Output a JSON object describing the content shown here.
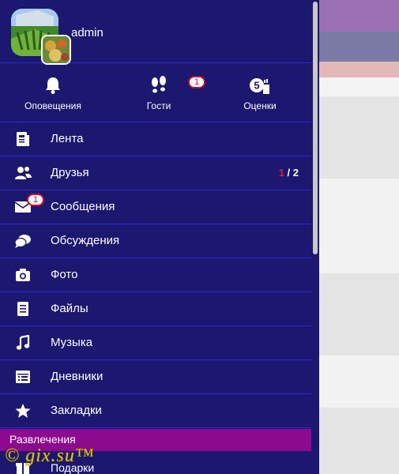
{
  "colors": {
    "drawer_bg": "#1c1870",
    "divider": "#2a2ad8",
    "section_bg": "#8b0a8d",
    "badge_border": "#c8102e",
    "watermark": "#e6c228"
  },
  "profile": {
    "username": "admin"
  },
  "quick_actions": [
    {
      "label": "Оповещения",
      "icon": "bell-icon"
    },
    {
      "label": "Гости",
      "icon": "footprints-icon",
      "badge": "1"
    },
    {
      "label": "Оценки",
      "icon": "rating-five-icon",
      "icon_text": "5"
    }
  ],
  "menu": [
    {
      "label": "Лента",
      "icon": "feed-icon"
    },
    {
      "label": "Друзья",
      "icon": "friends-icon",
      "count_new": "1",
      "count_total": " / 2"
    },
    {
      "label": "Сообщения",
      "icon": "envelope-icon",
      "badge": "1"
    },
    {
      "label": "Обсуждения",
      "icon": "chat-bubbles-icon"
    },
    {
      "label": "Фото",
      "icon": "camera-icon"
    },
    {
      "label": "Файлы",
      "icon": "file-icon"
    },
    {
      "label": "Музыка",
      "icon": "music-note-icon"
    },
    {
      "label": "Дневники",
      "icon": "diary-icon"
    },
    {
      "label": "Закладки",
      "icon": "star-icon"
    }
  ],
  "section": {
    "label": "Развлечения"
  },
  "gifts": {
    "label": "Подарки",
    "icon": "gift-icon"
  },
  "watermark": "© gix.su™"
}
